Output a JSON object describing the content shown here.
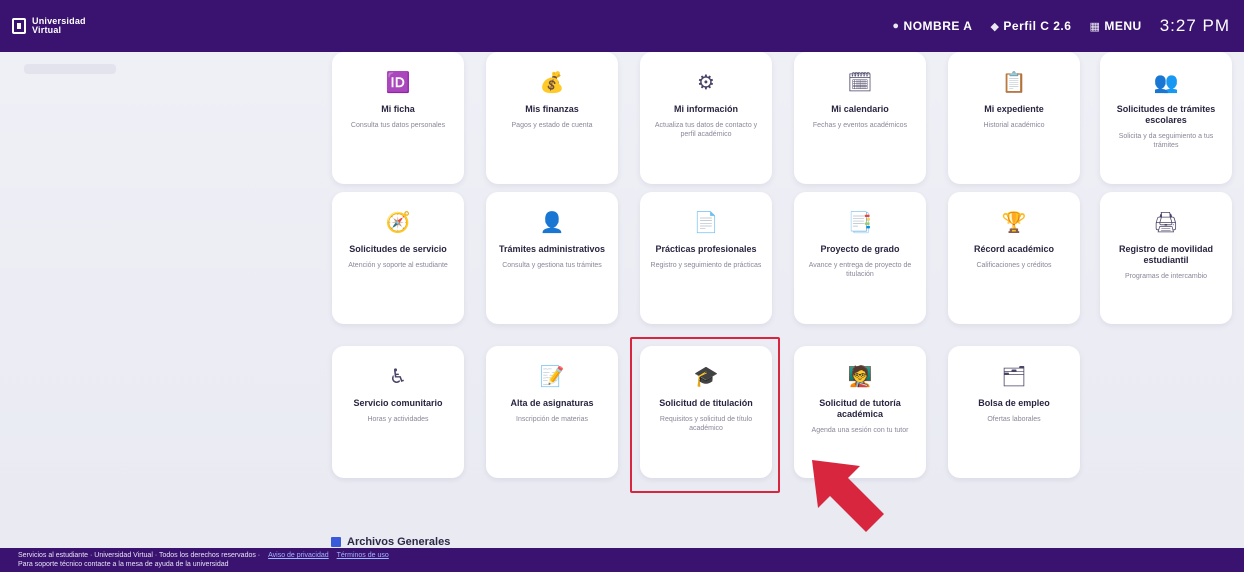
{
  "header": {
    "logo_text": "Universidad\nVirtual",
    "items": [
      {
        "icon": "user-icon",
        "label": "NOMBRE A"
      },
      {
        "icon": "settings-icon",
        "label": "Perfil C 2.6"
      },
      {
        "icon": "grid-icon",
        "label": "MENU"
      }
    ],
    "clock": "3:27 PM"
  },
  "cards": [
    {
      "icon": "🆔",
      "title": "Mi ficha",
      "desc": "Consulta tus datos personales"
    },
    {
      "icon": "💰",
      "title": "Mis finanzas",
      "desc": "Pagos y estado de cuenta"
    },
    {
      "icon": "⚙",
      "title": "Mi información",
      "desc": "Actualiza tus datos de contacto y perfil académico"
    },
    {
      "icon": "🗓",
      "title": "Mi calendario",
      "desc": "Fechas y eventos académicos"
    },
    {
      "icon": "📋",
      "title": "Mi expediente",
      "desc": "Historial académico"
    },
    {
      "icon": "👥",
      "title": "Solicitudes de trámites escolares",
      "desc": "Solicita y da seguimiento a tus trámites"
    },
    {
      "icon": "🧭",
      "title": "Solicitudes de servicio",
      "desc": "Atención y soporte al estudiante"
    },
    {
      "icon": "👤",
      "title": "Trámites administrativos",
      "desc": "Consulta y gestiona tus trámites"
    },
    {
      "icon": "📄",
      "title": "Prácticas profesionales",
      "desc": "Registro y seguimiento de prácticas"
    },
    {
      "icon": "📑",
      "title": "Proyecto de grado",
      "desc": "Avance y entrega de proyecto de titulación"
    },
    {
      "icon": "🏆",
      "title": "Récord académico",
      "desc": "Calificaciones y créditos"
    },
    {
      "icon": "🖨",
      "title": "Registro de movilidad estudiantil",
      "desc": "Programas de intercambio"
    },
    {
      "icon": "♿",
      "title": "Servicio comunitario",
      "desc": "Horas y actividades"
    },
    {
      "icon": "📝",
      "title": "Alta de asignaturas",
      "desc": "Inscripción de materias"
    },
    {
      "icon": "🎓",
      "title": "Solicitud de titulación",
      "desc": "Requisitos y solicitud de título académico"
    },
    {
      "icon": "🧑‍🏫",
      "title": "Solicitud de tutoría académica",
      "desc": "Agenda una sesión con tu tutor"
    },
    {
      "icon": "🗂",
      "title": "Bolsa de empleo",
      "desc": "Ofertas laborales"
    }
  ],
  "archivos_label": "Archivos Generales",
  "footer": {
    "line1": "Servicios al estudiante · Universidad Virtual · Todos los derechos reservados ·",
    "link1": "Aviso de privacidad",
    "link2": "Términos de uso",
    "line2": "Para soporte técnico contacte a la mesa de ayuda de la universidad"
  },
  "colors": {
    "brand": "#3a1370",
    "highlight": "#d7263d",
    "arrow": "#d7263d"
  }
}
